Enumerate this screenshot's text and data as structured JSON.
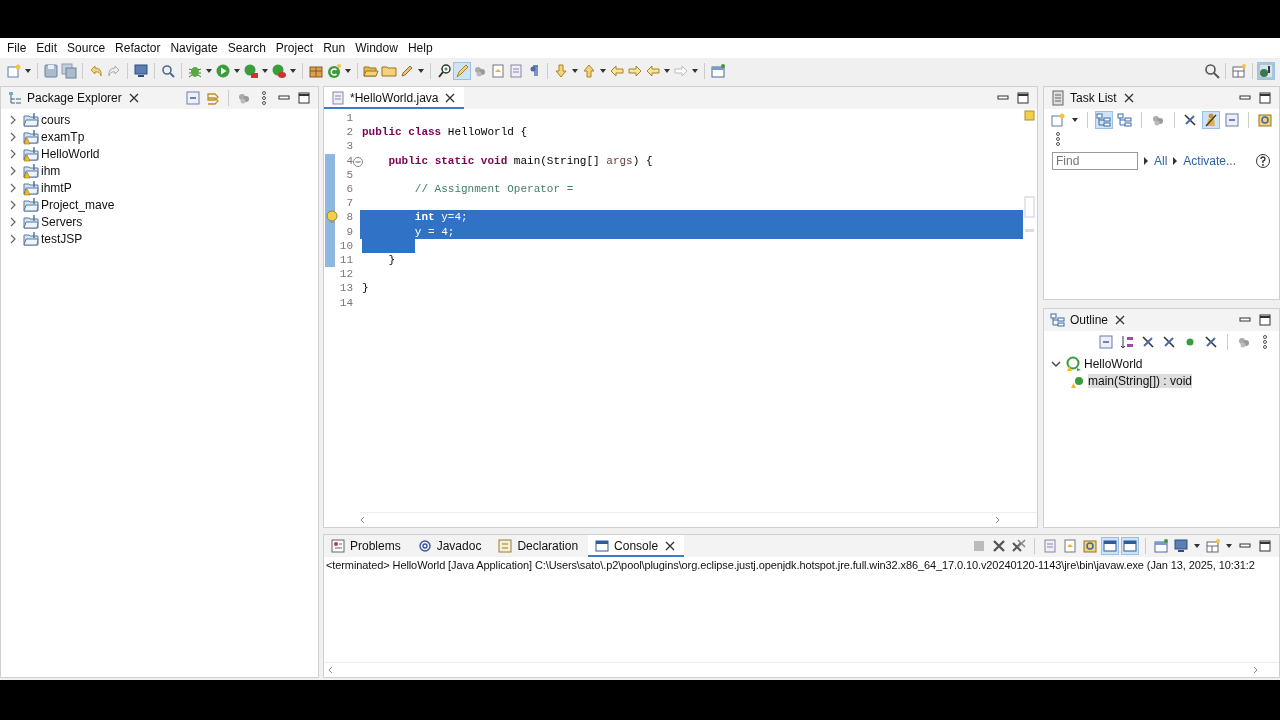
{
  "menu": [
    "File",
    "Edit",
    "Source",
    "Refactor",
    "Navigate",
    "Search",
    "Project",
    "Run",
    "Window",
    "Help"
  ],
  "package_explorer": {
    "tab": {
      "label": "Package Explorer",
      "selected": false
    },
    "projects": [
      {
        "name": "cours",
        "expanded": false,
        "warning": false
      },
      {
        "name": "examTp",
        "expanded": false,
        "warning": true
      },
      {
        "name": "HelloWorld",
        "expanded": false,
        "warning": true
      },
      {
        "name": "ihm",
        "expanded": false,
        "warning": true
      },
      {
        "name": "ihmtP",
        "expanded": false,
        "warning": true
      },
      {
        "name": "Project_mave",
        "expanded": false,
        "warning": false
      },
      {
        "name": "Servers",
        "expanded": false,
        "warning": false
      },
      {
        "name": "testJSP",
        "expanded": false,
        "warning": false
      }
    ]
  },
  "editor": {
    "tab": {
      "label": "*HelloWorld.java",
      "selected": true
    },
    "lines": [
      {
        "number": "1",
        "fold": false,
        "changed": false,
        "warning": false,
        "selected": false,
        "partial": false
      },
      {
        "number": "2",
        "fold": false,
        "changed": false,
        "warning": false,
        "selected": false,
        "partial": false,
        "tokens": [
          {
            "kind": "keyword",
            "text": "public "
          },
          {
            "kind": "keyword",
            "text": "class "
          },
          {
            "kind": "plain",
            "text": "HelloWorld {"
          }
        ]
      },
      {
        "number": "3",
        "fold": false,
        "changed": false,
        "warning": false,
        "selected": false,
        "partial": false
      },
      {
        "number": "4",
        "fold": true,
        "changed": true,
        "warning": false,
        "selected": false,
        "partial": false,
        "tokens": [
          {
            "kind": "keyword",
            "text": "    public "
          },
          {
            "kind": "keyword",
            "text": "static "
          },
          {
            "kind": "keyword",
            "text": "void "
          },
          {
            "kind": "plain",
            "text": "main(String[] "
          },
          {
            "kind": "param",
            "text": "args"
          },
          {
            "kind": "plain",
            "text": ") {"
          }
        ]
      },
      {
        "number": "5",
        "fold": false,
        "changed": true,
        "warning": false,
        "selected": false,
        "partial": false
      },
      {
        "number": "6",
        "fold": false,
        "changed": true,
        "warning": false,
        "selected": false,
        "partial": false,
        "tokens": [
          {
            "kind": "comment",
            "text": "        // Assignment Operator ="
          }
        ]
      },
      {
        "number": "7",
        "fold": false,
        "changed": true,
        "warning": false,
        "selected": false,
        "partial": false
      },
      {
        "number": "8",
        "fold": false,
        "changed": true,
        "warning": true,
        "selected": true,
        "partial": false,
        "tokens": [
          {
            "kind": "keyword",
            "text": "        int"
          },
          {
            "kind": "plain",
            "text": " y=4;"
          }
        ]
      },
      {
        "number": "9",
        "fold": false,
        "changed": true,
        "warning": false,
        "selected": true,
        "partial": false,
        "tokens": [
          {
            "kind": "plain",
            "text": "        y = 4;"
          }
        ]
      },
      {
        "number": "10",
        "fold": false,
        "changed": true,
        "warning": false,
        "selected": false,
        "partial": true
      },
      {
        "number": "11",
        "fold": false,
        "changed": true,
        "warning": false,
        "selected": false,
        "partial": false,
        "tokens": [
          {
            "kind": "plain",
            "text": "    }"
          }
        ]
      },
      {
        "number": "12",
        "fold": false,
        "changed": false,
        "warning": false,
        "selected": false,
        "partial": false
      },
      {
        "number": "13",
        "fold": false,
        "changed": false,
        "warning": false,
        "selected": false,
        "partial": false,
        "tokens": [
          {
            "kind": "plain",
            "text": "}"
          }
        ]
      },
      {
        "number": "14",
        "fold": false,
        "changed": false,
        "warning": false,
        "selected": false,
        "partial": false
      }
    ]
  },
  "task_list": {
    "tab": {
      "label": "Task List",
      "selected": false
    },
    "find": {
      "placeholder": "Find"
    },
    "links": [
      "All",
      "Activate..."
    ]
  },
  "outline": {
    "tab": {
      "label": "Outline",
      "selected": false
    },
    "items": [
      {
        "label": "HelloWorld",
        "expanded": true,
        "selected": false,
        "children": [
          {
            "label": "main(String[]) : void",
            "selected": true
          }
        ]
      }
    ]
  },
  "bottom_panel": {
    "tabs": [
      {
        "kind": "problems",
        "label": "Problems",
        "selected": false
      },
      {
        "kind": "javadoc",
        "label": "Javadoc",
        "selected": false
      },
      {
        "kind": "declaration",
        "label": "Declaration",
        "selected": false
      },
      {
        "kind": "console",
        "label": "Console",
        "selected": true
      }
    ],
    "console_line": "<terminated> HelloWorld [Java Application] C:\\Users\\sato\\.p2\\pool\\plugins\\org.eclipse.justj.openjdk.hotspot.jre.full.win32.x86_64_17.0.10.v20240120-1143\\jre\\bin\\javaw.exe  (Jan 13, 2025, 10:31:2"
  }
}
